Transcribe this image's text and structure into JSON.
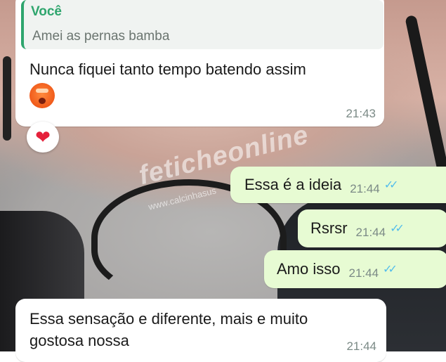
{
  "watermark": {
    "brand": "feticheonline",
    "site": "www.calcinhasus"
  },
  "messages": [
    {
      "direction": "incoming",
      "quote": {
        "author": "Você",
        "text": "Amei as pernas bamba"
      },
      "text": "Nunca fiquei tanto tempo batendo assim",
      "emoji": "hot-face-emoji",
      "time": "21:43",
      "reaction": "❤",
      "reaction_icon": "heart-reaction-icon"
    },
    {
      "direction": "outgoing",
      "text": "Essa é a ideia",
      "time": "21:44",
      "status": "read",
      "ticks": "✓✓"
    },
    {
      "direction": "outgoing",
      "text": "Rsrsr",
      "time": "21:44",
      "status": "read",
      "ticks": "✓✓"
    },
    {
      "direction": "outgoing",
      "text": "Amo isso",
      "time": "21:44",
      "status": "read",
      "ticks": "✓✓"
    },
    {
      "direction": "incoming",
      "text": "Essa sensação e diferente, mais e muito gostosa nossa",
      "time": "21:44"
    }
  ],
  "colors": {
    "incoming_bubble": "#ffffff",
    "outgoing_bubble": "#e7fbd3",
    "quote_accent": "#2ea56d",
    "read_ticks": "#53bdeb",
    "reaction_heart": "#e5213b"
  }
}
